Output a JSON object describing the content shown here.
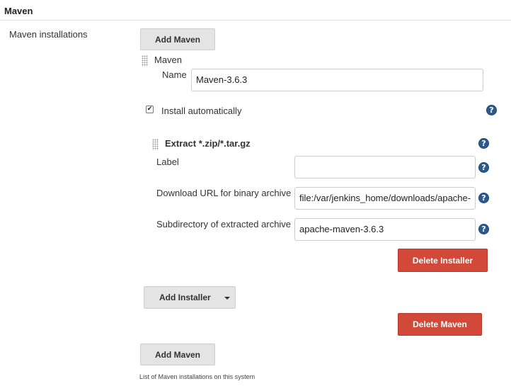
{
  "section": {
    "title": "Maven"
  },
  "maven_installations": {
    "label": "Maven installations",
    "add_button_top": "Add Maven",
    "add_button_bottom": "Add Maven",
    "footer_note": "List of Maven installations on this system"
  },
  "installation": {
    "header": "Maven",
    "name_label": "Name",
    "name_value": "Maven-3.6.3",
    "install_auto_label": "Install automatically",
    "install_auto_checked": true,
    "delete_button": "Delete Maven"
  },
  "installer": {
    "header": "Extract *.zip/*.tar.gz",
    "label_label": "Label",
    "label_value": "",
    "url_label": "Download URL for binary archive",
    "url_value": "file:/var/jenkins_home/downloads/apache-",
    "subdir_label": "Subdirectory of extracted archive",
    "subdir_value": "apache-maven-3.6.3",
    "delete_button": "Delete Installer",
    "add_installer_button": "Add Installer"
  },
  "icons": {
    "help": "help-icon",
    "grip": "drag-handle-icon",
    "check": "checkmark-icon",
    "dropdown": "caret-down-icon",
    "help_glyph": "?",
    "check_glyph": "✔"
  },
  "colors": {
    "danger": "#d24939",
    "help": "#2b5a8c",
    "button_grey": "#e4e4e4"
  }
}
